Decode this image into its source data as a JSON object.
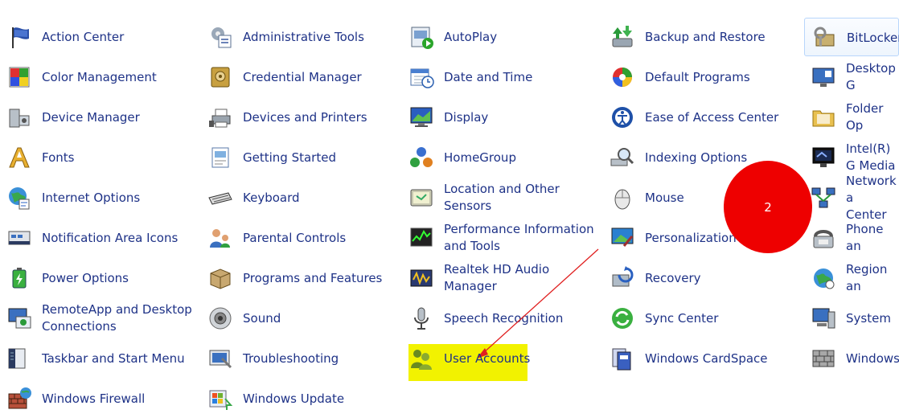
{
  "items": [
    {
      "id": "action-center",
      "label": "Action Center",
      "icon": "flag-icon"
    },
    {
      "id": "administrative-tools",
      "label": "Administrative Tools",
      "icon": "admin-tools-icon"
    },
    {
      "id": "autoplay",
      "label": "AutoPlay",
      "icon": "autoplay-icon"
    },
    {
      "id": "backup-and-restore",
      "label": "Backup and Restore",
      "icon": "backup-icon"
    },
    {
      "id": "bitlocker",
      "label": "BitLocker",
      "icon": "bitlocker-icon"
    },
    {
      "id": "color-management",
      "label": "Color Management",
      "icon": "color-management-icon"
    },
    {
      "id": "credential-manager",
      "label": "Credential Manager",
      "icon": "credential-vault-icon"
    },
    {
      "id": "date-and-time",
      "label": "Date and Time",
      "icon": "calendar-clock-icon"
    },
    {
      "id": "default-programs",
      "label": "Default Programs",
      "icon": "default-programs-icon"
    },
    {
      "id": "desktop-gadgets",
      "label": "Desktop G",
      "icon": "desktop-gadgets-icon"
    },
    {
      "id": "device-manager",
      "label": "Device Manager",
      "icon": "device-manager-icon"
    },
    {
      "id": "devices-and-printers",
      "label": "Devices and Printers",
      "icon": "printer-icon"
    },
    {
      "id": "display",
      "label": "Display",
      "icon": "display-monitor-icon"
    },
    {
      "id": "ease-of-access-center",
      "label": "Ease of Access Center",
      "icon": "ease-of-access-icon"
    },
    {
      "id": "folder-options",
      "label": "Folder Op",
      "icon": "folder-icon"
    },
    {
      "id": "fonts",
      "label": "Fonts",
      "icon": "fonts-icon"
    },
    {
      "id": "getting-started",
      "label": "Getting Started",
      "icon": "getting-started-icon"
    },
    {
      "id": "homegroup",
      "label": "HomeGroup",
      "icon": "homegroup-icon"
    },
    {
      "id": "indexing-options",
      "label": "Indexing Options",
      "icon": "indexing-magnifier-icon"
    },
    {
      "id": "intel-graphics",
      "label": "Intel(R) G Media",
      "icon": "intel-graphics-monitor-icon"
    },
    {
      "id": "internet-options",
      "label": "Internet Options",
      "icon": "internet-globe-icon"
    },
    {
      "id": "keyboard",
      "label": "Keyboard",
      "icon": "keyboard-icon"
    },
    {
      "id": "location-and-other-sensors",
      "label": "Location and Other Sensors",
      "icon": "location-sensors-icon"
    },
    {
      "id": "mouse",
      "label": "Mouse",
      "icon": "mouse-icon"
    },
    {
      "id": "network-center",
      "label": "Network a Center",
      "icon": "network-icon"
    },
    {
      "id": "notification-area-icons",
      "label": "Notification Area Icons",
      "icon": "notification-area-icon"
    },
    {
      "id": "parental-controls",
      "label": "Parental Controls",
      "icon": "parental-controls-icon"
    },
    {
      "id": "performance-information",
      "label": "Performance Information and Tools",
      "icon": "performance-chart-icon"
    },
    {
      "id": "personalization",
      "label": "Personalization",
      "icon": "personalization-icon"
    },
    {
      "id": "phone-and-modem",
      "label": "Phone an",
      "icon": "phone-modem-icon"
    },
    {
      "id": "power-options",
      "label": "Power Options",
      "icon": "power-battery-icon"
    },
    {
      "id": "programs-and-features",
      "label": "Programs and Features",
      "icon": "programs-box-icon"
    },
    {
      "id": "realtek-hd-audio-manager",
      "label": "Realtek HD Audio Manager",
      "icon": "audio-manager-icon"
    },
    {
      "id": "recovery",
      "label": "Recovery",
      "icon": "recovery-icon"
    },
    {
      "id": "region",
      "label": "Region an",
      "icon": "region-globe-icon"
    },
    {
      "id": "remoteapp",
      "label": "RemoteApp and Desktop Connections",
      "icon": "remoteapp-icon"
    },
    {
      "id": "sound",
      "label": "Sound",
      "icon": "speaker-icon"
    },
    {
      "id": "speech-recognition",
      "label": "Speech Recognition",
      "icon": "microphone-icon"
    },
    {
      "id": "sync-center",
      "label": "Sync Center",
      "icon": "sync-arrows-icon"
    },
    {
      "id": "system",
      "label": "System",
      "icon": "system-computer-icon"
    },
    {
      "id": "taskbar-and-start-menu",
      "label": "Taskbar and Start Menu",
      "icon": "taskbar-icon"
    },
    {
      "id": "troubleshooting",
      "label": "Troubleshooting",
      "icon": "troubleshooting-icon"
    },
    {
      "id": "user-accounts",
      "label": "User Accounts",
      "icon": "user-accounts-icon"
    },
    {
      "id": "windows-cardspace",
      "label": "Windows CardSpace",
      "icon": "cardspace-icon"
    },
    {
      "id": "windows-firewall-partial",
      "label": "Windows",
      "icon": "firewall-wall-icon"
    },
    {
      "id": "windows-firewall",
      "label": "Windows Firewall",
      "icon": "firewall-icon"
    },
    {
      "id": "windows-update",
      "label": "Windows Update",
      "icon": "windows-update-icon"
    }
  ],
  "annotation": {
    "number": "2",
    "circle_color": "#ee0000",
    "arrow_color": "#e02020",
    "highlight_color": "#f2f200"
  },
  "colors": {
    "link_text": "#1e3287",
    "selection_border": "#b8d6fb"
  }
}
